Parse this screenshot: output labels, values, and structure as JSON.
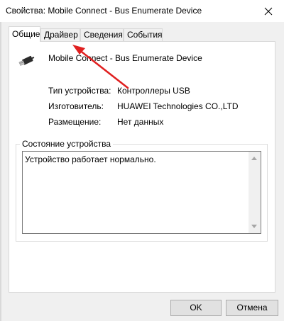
{
  "window": {
    "title": "Свойства: Mobile Connect - Bus Enumerate Device",
    "close_icon": "close-icon"
  },
  "tabs": [
    {
      "label": "Общие",
      "active": true
    },
    {
      "label": "Драйвер",
      "active": false
    },
    {
      "label": "Сведения",
      "active": false
    },
    {
      "label": "События",
      "active": false
    }
  ],
  "device": {
    "name": "Mobile Connect - Bus Enumerate Device",
    "icon": "usb-cable-icon"
  },
  "properties": [
    {
      "label": "Тип устройства:",
      "value": "Контроллеры USB"
    },
    {
      "label": "Изготовитель:",
      "value": "HUAWEI Technologies CO.,LTD"
    },
    {
      "label": "Размещение:",
      "value": "Нет данных"
    }
  ],
  "status": {
    "group_title": "Состояние устройства",
    "text": "Устройство работает нормально."
  },
  "buttons": {
    "ok": "OK",
    "cancel": "Отмена"
  },
  "annotation": {
    "arrow_color": "#e02020",
    "points_to": "tab-driver"
  }
}
